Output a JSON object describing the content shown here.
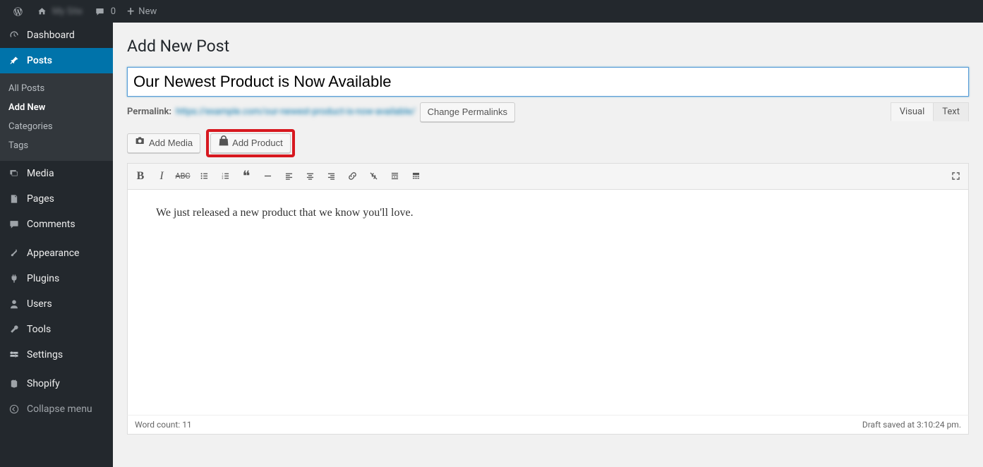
{
  "adminbar": {
    "site_name": "My Site",
    "comments_count": "0",
    "new_label": "New"
  },
  "sidebar": {
    "dashboard": "Dashboard",
    "posts": "Posts",
    "posts_sub": {
      "all": "All Posts",
      "add_new": "Add New",
      "categories": "Categories",
      "tags": "Tags"
    },
    "media": "Media",
    "pages": "Pages",
    "comments": "Comments",
    "appearance": "Appearance",
    "plugins": "Plugins",
    "users": "Users",
    "tools": "Tools",
    "settings": "Settings",
    "shopify": "Shopify",
    "collapse": "Collapse menu"
  },
  "page": {
    "title": "Add New Post",
    "post_title_value": "Our Newest Product is Now Available",
    "permalink_label": "Permalink:",
    "permalink_url": "https://example.com/our-newest-product-is-now-available/",
    "change_permalinks": "Change Permalinks",
    "add_media": "Add Media",
    "add_product": "Add Product",
    "tab_visual": "Visual",
    "tab_text": "Text",
    "editor_content": "We just released a new product that we know you'll love.",
    "word_count_label": "Word count: ",
    "word_count": "11",
    "save_status": "Draft saved at 3:10:24 pm."
  }
}
